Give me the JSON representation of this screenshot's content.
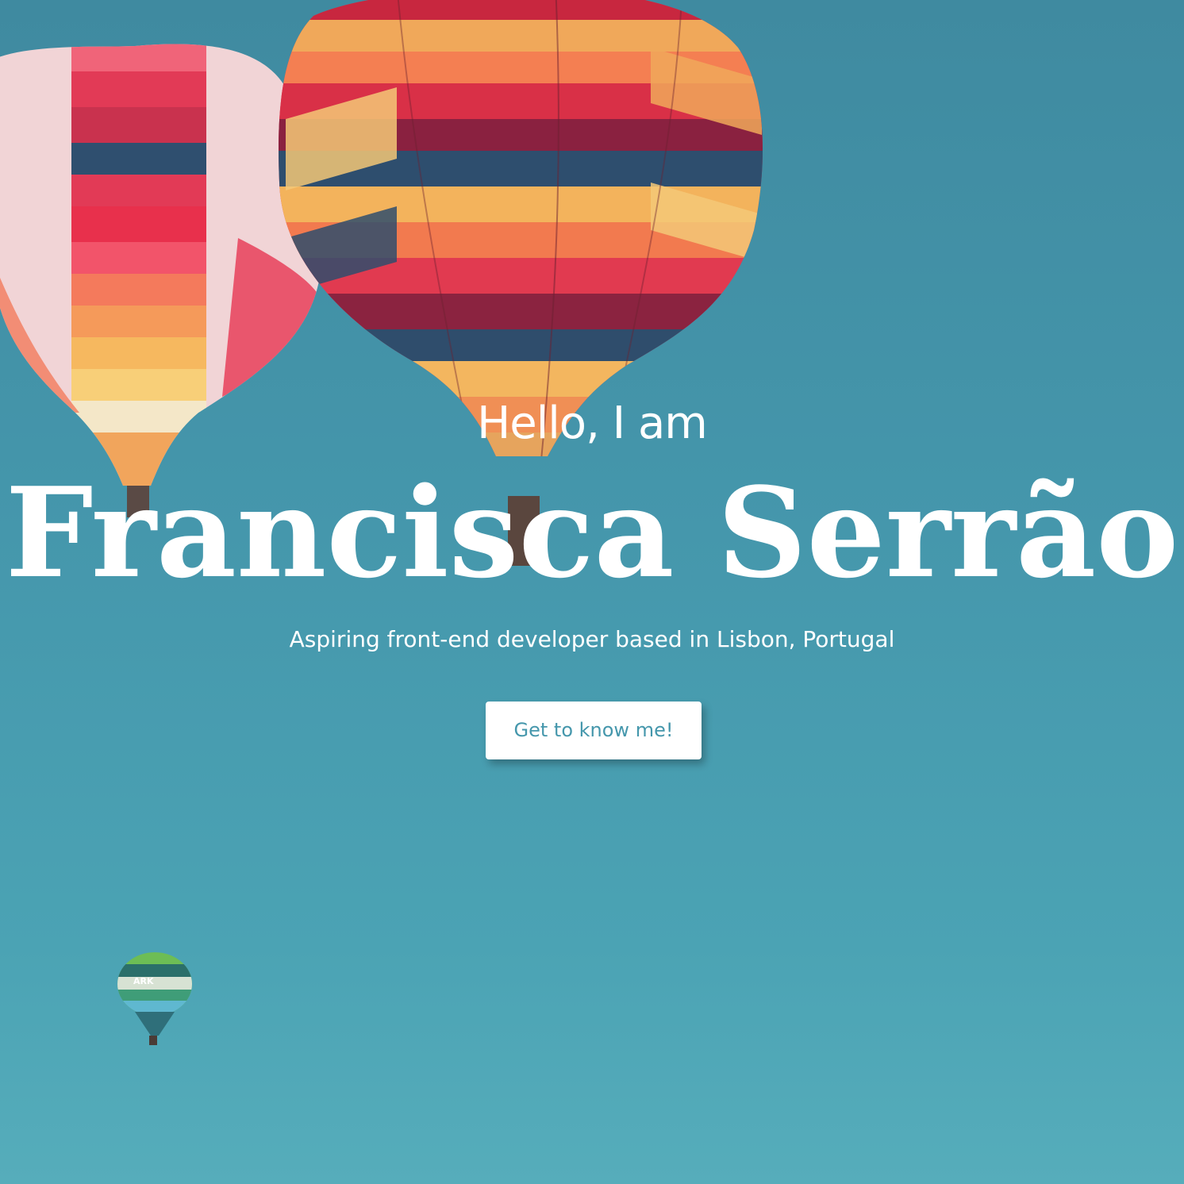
{
  "hero": {
    "greeting": "Hello, I am",
    "name": "Francisca Serrão",
    "tagline": "Aspiring front-end developer based in Lisbon, Portugal",
    "cta_label": "Get to know me!",
    "small_balloon_text": "ARK"
  },
  "colors": {
    "sky_top": "#3f8aa0",
    "sky_bottom": "#56adbb",
    "text": "#ffffff",
    "button_bg": "#ffffff",
    "button_text": "#4597ac"
  }
}
